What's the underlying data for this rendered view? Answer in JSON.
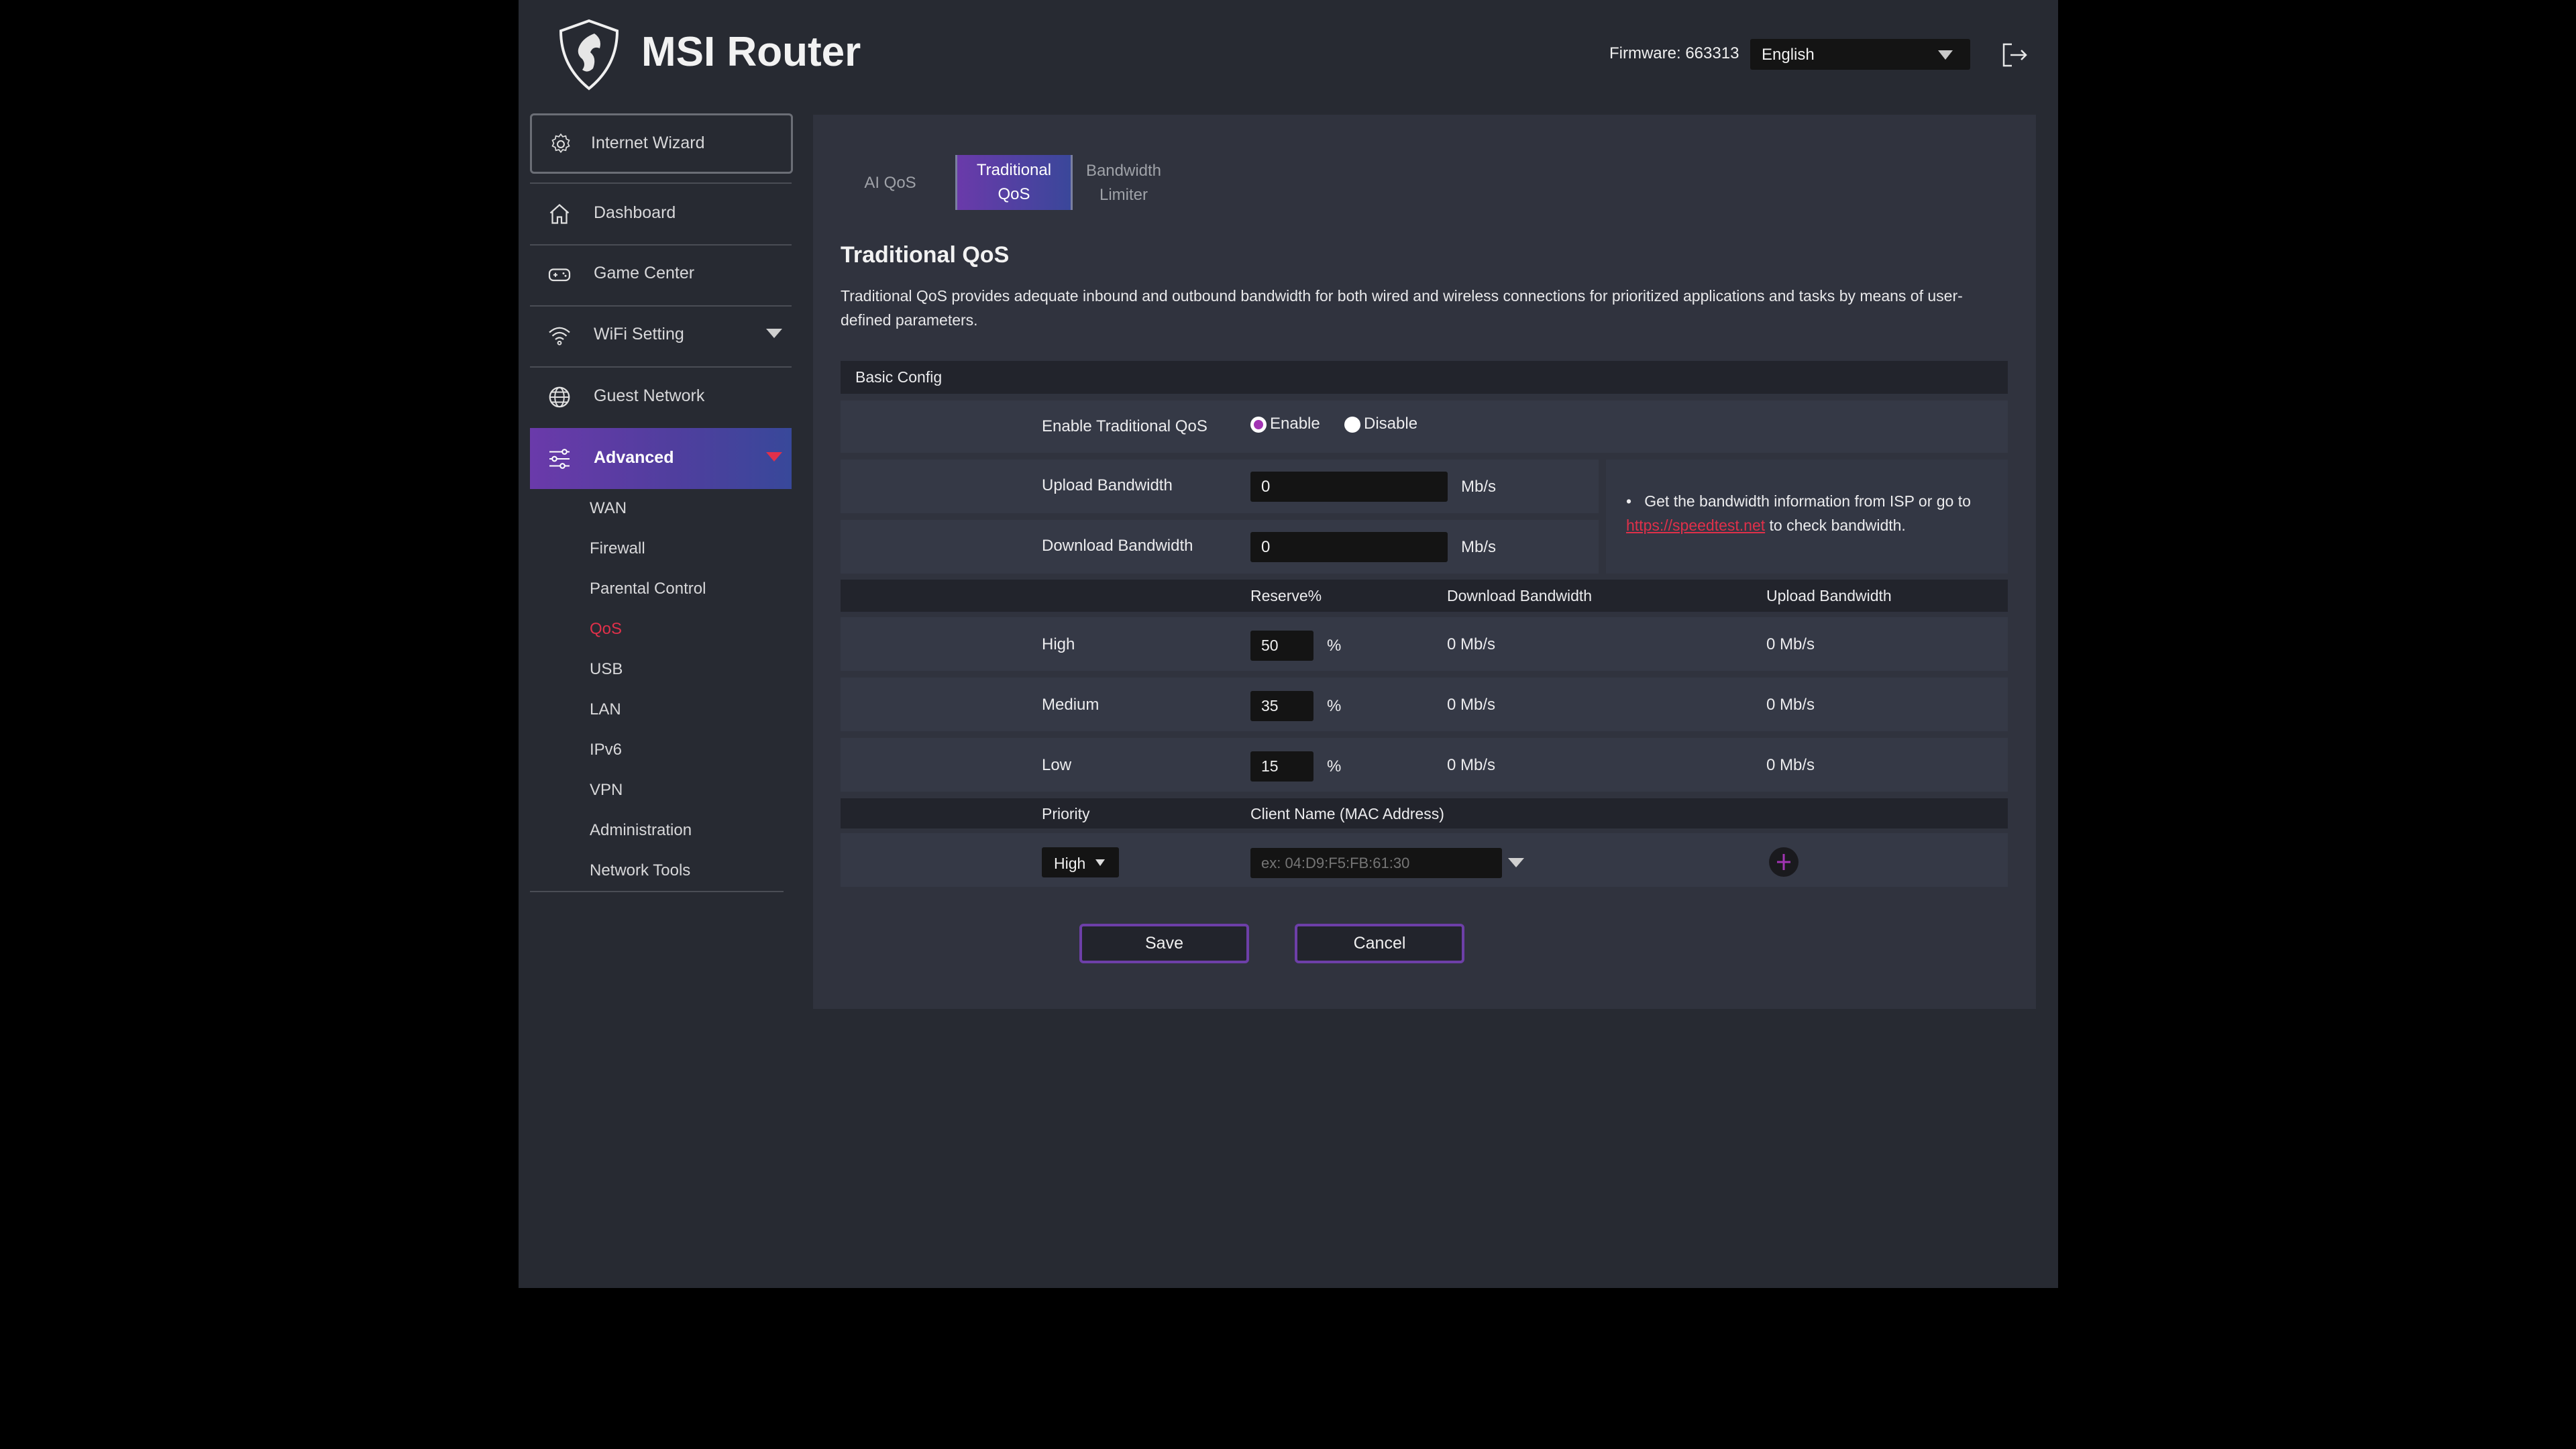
{
  "header": {
    "app_title": "MSI Router",
    "firmware": "Firmware: 663313",
    "language": "English",
    "logout_icon": "logout-icon"
  },
  "sidebar": {
    "wizard": {
      "label": "Internet Wizard",
      "icon": "gear-icon"
    },
    "items": [
      {
        "label": "Dashboard",
        "icon": "home-icon"
      },
      {
        "label": "Game Center",
        "icon": "gamepad-icon"
      },
      {
        "label": "WiFi Setting",
        "icon": "wifi-icon"
      },
      {
        "label": "Guest Network",
        "icon": "globe-icon"
      },
      {
        "label": "Advanced",
        "icon": "sliders-icon"
      }
    ],
    "sub_items": [
      "WAN",
      "Firewall",
      "Parental Control",
      "QoS",
      "USB",
      "LAN",
      "IPv6",
      "VPN",
      "Administration",
      "Network Tools"
    ],
    "active_sub": "QoS"
  },
  "tabs": [
    {
      "label": "AI QoS"
    },
    {
      "label": "Traditional QoS",
      "active": true
    },
    {
      "label": "Bandwidth Limiter"
    }
  ],
  "page": {
    "heading": "Traditional QoS",
    "description": "Traditional QoS provides adequate inbound and outbound bandwidth for both wired and wireless connections for prioritized applications and tasks by means of user-defined parameters."
  },
  "basic_config": {
    "section_title": "Basic Config",
    "enable_label": "Enable Traditional QoS",
    "enable_option": "Enable",
    "disable_option": "Disable",
    "selected": "Enable",
    "upload_label": "Upload Bandwidth",
    "upload_value": "0",
    "download_label": "Download Bandwidth",
    "download_value": "0",
    "unit": "Mb/s",
    "info_text_before": "Get the bandwidth information from ISP or go to",
    "info_link": "https://speedtest.net",
    "info_text_after": " to check bandwidth."
  },
  "reserve_table": {
    "headers": [
      "",
      "Reserve%",
      "Download Bandwidth",
      "Upload Bandwidth"
    ],
    "rows": [
      {
        "level": "High",
        "reserve": "50",
        "pct": "%",
        "download": "0 Mb/s",
        "upload": "0 Mb/s"
      },
      {
        "level": "Medium",
        "reserve": "35",
        "pct": "%",
        "download": "0 Mb/s",
        "upload": "0 Mb/s"
      },
      {
        "level": "Low",
        "reserve": "15",
        "pct": "%",
        "download": "0 Mb/s",
        "upload": "0 Mb/s"
      }
    ]
  },
  "client_table": {
    "headers": [
      "Priority",
      "Client Name (MAC Address)"
    ],
    "priority_value": "High",
    "mac_placeholder": "ex: 04:D9:F5:FB:61:30"
  },
  "actions": {
    "save": "Save",
    "cancel": "Cancel"
  },
  "colors": {
    "accent_red": "#e0304a",
    "accent_purple": "#6d3fa8",
    "bg": "#272a32",
    "panel": "#30333e"
  }
}
